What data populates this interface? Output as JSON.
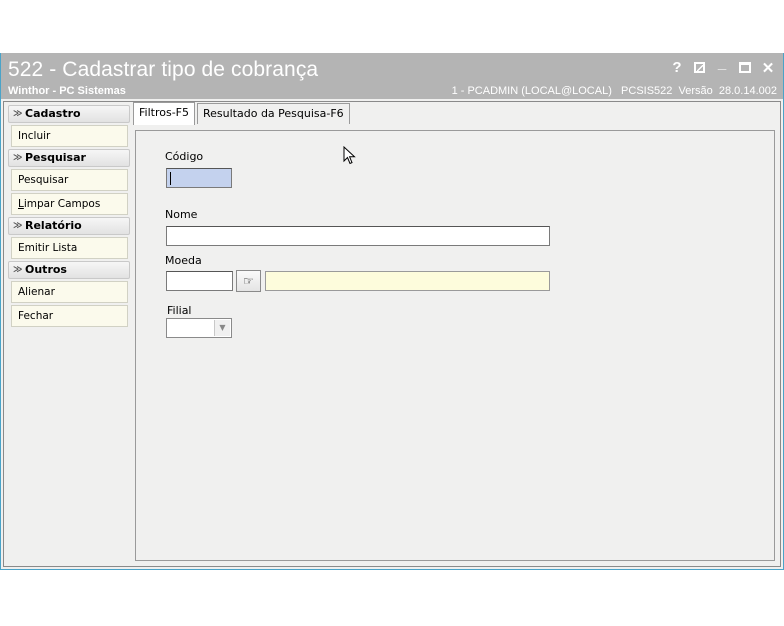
{
  "window": {
    "title": "522 - Cadastrar tipo de cobrança",
    "subtitle": "Winthor - PC Sistemas",
    "info": "1 - PCADMIN (LOCAL@LOCAL)   PCSIS522  Versão  28.0.14.002",
    "controls": {
      "help": "?",
      "minimize": "_",
      "close": "✕"
    }
  },
  "sidebar": {
    "groups": [
      {
        "title": "Cadastro",
        "items": [
          "Incluir"
        ]
      },
      {
        "title": "Pesquisar",
        "items": [
          "Pesquisar",
          "Limpar Campos"
        ]
      },
      {
        "title": "Relatório",
        "items": [
          "Emitir Lista"
        ]
      },
      {
        "title": "Outros",
        "items": [
          "Alienar",
          "Fechar"
        ]
      }
    ]
  },
  "tabs": [
    {
      "label": "Filtros-F5",
      "active": true
    },
    {
      "label": "Resultado da Pesquisa-F6",
      "active": false
    }
  ],
  "form": {
    "codigo": {
      "label": "Código",
      "value": ""
    },
    "nome": {
      "label": "Nome",
      "value": ""
    },
    "moeda": {
      "label": "Moeda",
      "value": "",
      "description": ""
    },
    "filial": {
      "label": "Filial",
      "value": ""
    }
  },
  "icons": {
    "lookup": "lookup-icon",
    "dropdown": "chevron-down-icon",
    "group_chevron": "double-chevron-icon"
  },
  "colors": {
    "titlebar": "#b4b4b4",
    "focused_field": "#c4d2ee",
    "readonly_field": "#fdfcdc",
    "sidebar_item": "#fbfaec"
  }
}
